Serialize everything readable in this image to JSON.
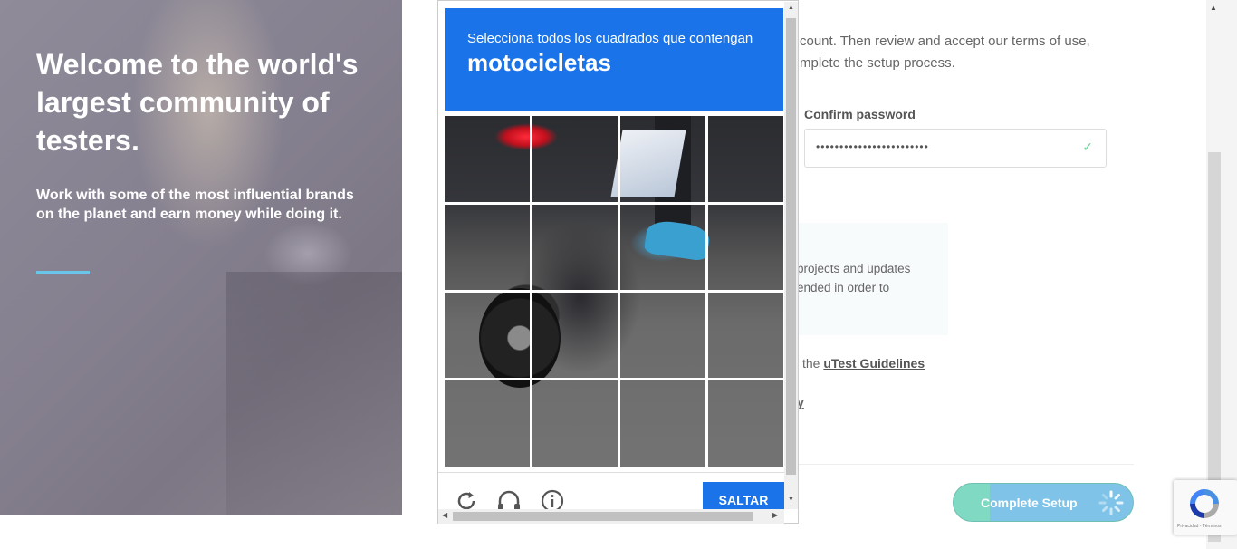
{
  "hero": {
    "title": "Welcome to the world's largest community of testers.",
    "subtitle": "Work with some of the most influential brands on the planet and earn money while doing it."
  },
  "form": {
    "intro_line1": "count. Then review and accept our terms of use,",
    "intro_line2": "mplete the setup process.",
    "confirm_password_label": "Confirm password",
    "confirm_password_value": "••••••••••••••••••••••••",
    "notice_line1": "projects and updates",
    "notice_line2": "ended in order to",
    "guidelines_prefix": "the",
    "guidelines_link": "uTest Guidelines",
    "privacy_fragment": "y",
    "complete_button": "Complete Setup"
  },
  "captcha": {
    "instruction": "Selecciona todos los cuadrados que contengan",
    "target": "motocicletas",
    "skip_button": "SALTAR",
    "header_color": "#1a73e8",
    "icons": [
      "reload-icon",
      "headphones-icon",
      "info-icon"
    ]
  },
  "recaptcha_badge": {
    "links": "Privacidad - Términos"
  }
}
